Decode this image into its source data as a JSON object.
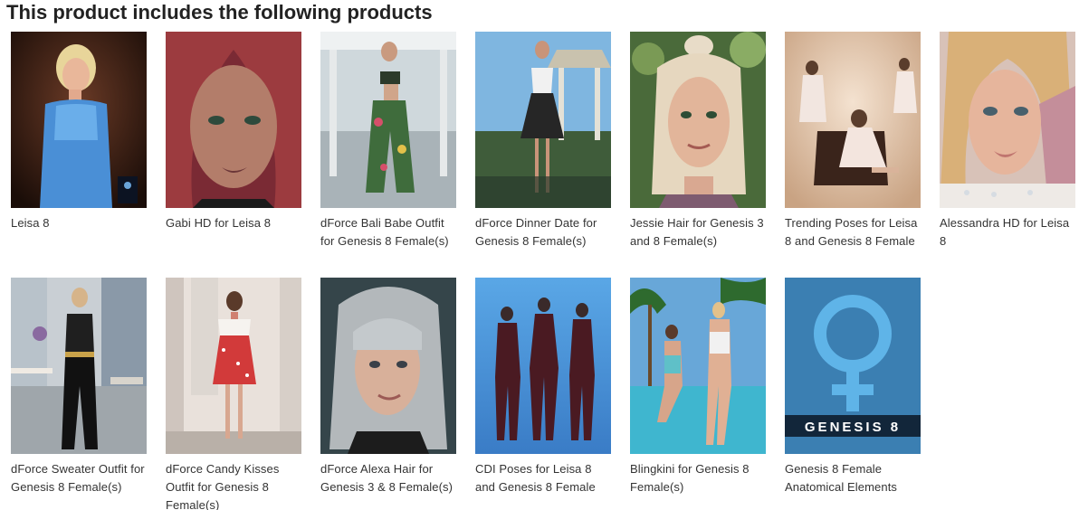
{
  "section": {
    "title": "This product includes the following products"
  },
  "products": [
    {
      "name": "Leisa 8"
    },
    {
      "name": "Gabi HD for Leisa 8"
    },
    {
      "name": "dForce Bali Babe Outfit for Genesis 8 Female(s)"
    },
    {
      "name": "dForce Dinner Date for Genesis 8 Female(s)"
    },
    {
      "name": "Jessie Hair for Genesis 3 and 8 Female(s)"
    },
    {
      "name": "Trending Poses for Leisa 8 and Genesis 8 Female"
    },
    {
      "name": "Alessandra HD for Leisa 8"
    },
    {
      "name": "dForce Sweater Outfit for Genesis 8 Female(s)"
    },
    {
      "name": "dForce Candy Kisses Outfit for Genesis 8 Female(s)"
    },
    {
      "name": "dForce Alexa Hair for Genesis 3 & 8 Female(s)"
    },
    {
      "name": "CDI Poses for Leisa 8 and Genesis 8 Female"
    },
    {
      "name": "Blingkini for Genesis 8 Female(s)"
    },
    {
      "name": "Genesis 8 Female Anatomical Elements",
      "thumb_text": "GENESIS 8"
    }
  ]
}
